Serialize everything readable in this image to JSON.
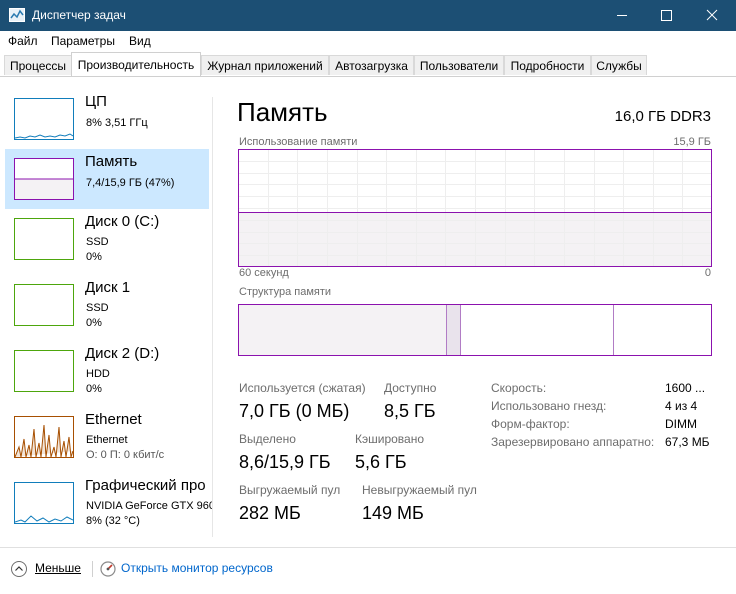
{
  "window": {
    "title": "Диспетчер задач"
  },
  "menu": [
    "Файл",
    "Параметры",
    "Вид"
  ],
  "tabs": [
    "Процессы",
    "Производительность",
    "Журнал приложений",
    "Автозагрузка",
    "Пользователи",
    "Подробности",
    "Службы"
  ],
  "sidebar": [
    {
      "title": "ЦП",
      "line1": "8%  3,51 ГГц"
    },
    {
      "title": "Память",
      "line1": "7,4/15,9 ГБ (47%)"
    },
    {
      "title": "Диск 0 (C:)",
      "line1": "SSD",
      "line2": "0%"
    },
    {
      "title": "Диск 1",
      "line1": "SSD",
      "line2": "0%"
    },
    {
      "title": "Диск 2 (D:)",
      "line1": "HDD",
      "line2": "0%"
    },
    {
      "title": "Ethernet",
      "line1": "Ethernet",
      "line2": "О: 0 П: 0 кбит/с"
    },
    {
      "title": "Графический про",
      "line1": "NVIDIA GeForce GTX 960",
      "line2": "8% (32 °C)"
    }
  ],
  "main": {
    "title": "Память",
    "spec": "16,0 ГБ DDR3",
    "usage_label": "Использование памяти",
    "usage_max": "15,9 ГБ",
    "time_left": "60 секунд",
    "time_right": "0",
    "usage_fraction": 0.47,
    "structure_label": "Структура памяти",
    "stats": {
      "in_use_label": "Используется (сжатая)",
      "in_use_value": "7,0 ГБ (0 МБ)",
      "available_label": "Доступно",
      "available_value": "8,5 ГБ",
      "committed_label": "Выделено",
      "committed_value": "8,6/15,9 ГБ",
      "cached_label": "Кэшировано",
      "cached_value": "5,6 ГБ",
      "paged_label": "Выгружаемый пул",
      "paged_value": "282 МБ",
      "nonpaged_label": "Невыгружаемый пул",
      "nonpaged_value": "149 МБ"
    },
    "details": [
      {
        "name": "Скорость:",
        "value": "1600 ..."
      },
      {
        "name": "Использовано гнезд:",
        "value": "4 из 4"
      },
      {
        "name": "Форм-фактор:",
        "value": "DIMM"
      },
      {
        "name": "Зарезервировано аппаратно:",
        "value": "67,3 МБ"
      }
    ]
  },
  "footer": {
    "less": "Меньше",
    "monitor": "Открыть монитор ресурсов"
  },
  "colors": {
    "titlebar": "#1c4f74",
    "memory": "#8b12ae",
    "disk": "#4da60c",
    "ethernet": "#a74f01",
    "cpu": "#117dbb",
    "selected": "#cce8ff",
    "link": "#0066cc"
  }
}
